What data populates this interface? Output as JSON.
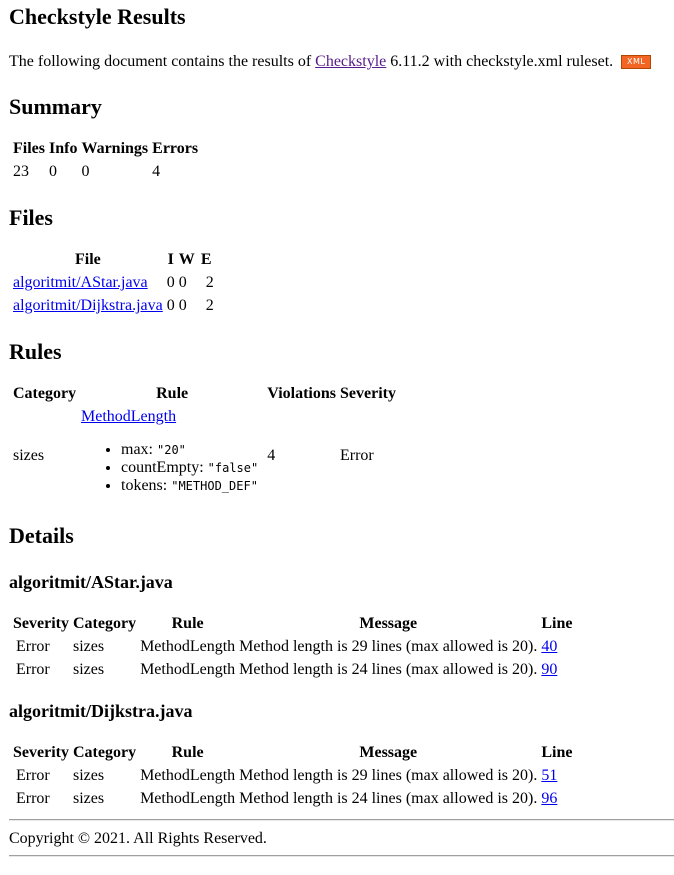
{
  "page_title": "Checkstyle Results",
  "intro": {
    "prefix": "The following document contains the results of",
    "link_text": "Checkstyle",
    "suffix": "6.11.2 with checkstyle.xml ruleset.",
    "badge_text": "XML"
  },
  "summary": {
    "heading": "Summary",
    "headers": [
      "Files",
      "Info",
      "Warnings",
      "Errors"
    ],
    "values": [
      "23",
      "0",
      "0",
      "4"
    ]
  },
  "files": {
    "heading": "Files",
    "headers": [
      "File",
      "I",
      "W",
      "E"
    ],
    "rows": [
      {
        "file": "algoritmit/AStar.java",
        "i": "0",
        "w": "0",
        "e": "2"
      },
      {
        "file": "algoritmit/Dijkstra.java",
        "i": "0",
        "w": "0",
        "e": "2"
      }
    ]
  },
  "rules": {
    "heading": "Rules",
    "headers": [
      "Category",
      "Rule",
      "Violations",
      "Severity"
    ],
    "row": {
      "category": "sizes",
      "rule_link": "MethodLength",
      "props": [
        {
          "name": "max:",
          "value": "\"20\""
        },
        {
          "name": "countEmpty:",
          "value": "\"false\""
        },
        {
          "name": "tokens:",
          "value": "\"METHOD_DEF\""
        }
      ],
      "violations": "4",
      "severity": "Error"
    }
  },
  "details": {
    "heading": "Details",
    "headers": [
      "Severity",
      "Category",
      "Rule",
      "Message",
      "Line"
    ],
    "files": [
      {
        "name": "algoritmit/AStar.java",
        "rows": [
          {
            "severity": "Error",
            "category": "sizes",
            "rule": "MethodLength",
            "message": "Method length is 29 lines (max allowed is 20).",
            "line": "40"
          },
          {
            "severity": "Error",
            "category": "sizes",
            "rule": "MethodLength",
            "message": "Method length is 24 lines (max allowed is 20).",
            "line": "90"
          }
        ]
      },
      {
        "name": "algoritmit/Dijkstra.java",
        "rows": [
          {
            "severity": "Error",
            "category": "sizes",
            "rule": "MethodLength",
            "message": "Method length is 29 lines (max allowed is 20).",
            "line": "51"
          },
          {
            "severity": "Error",
            "category": "sizes",
            "rule": "MethodLength",
            "message": "Method length is 24 lines (max allowed is 20).",
            "line": "96"
          }
        ]
      }
    ]
  },
  "footer": {
    "copyright": "Copyright © 2021. All Rights Reserved."
  },
  "colors": {
    "link": "#0000ee",
    "visited_link": "#551a8b",
    "xml_badge": "#f26522"
  }
}
